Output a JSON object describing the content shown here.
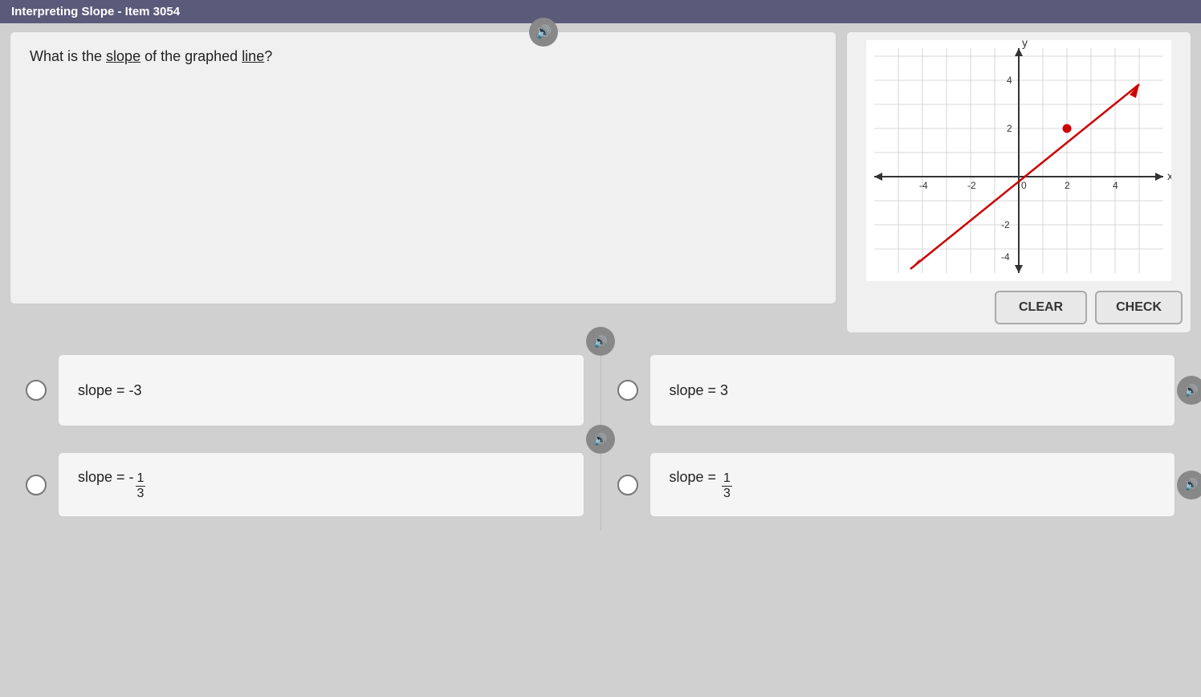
{
  "title": "Interpreting Slope - Item 3054",
  "question": {
    "text_before": "What is the ",
    "slope_word": "slope",
    "text_middle": " of the graphed ",
    "line_word": "line",
    "text_after": "?"
  },
  "buttons": {
    "clear": "CLEAR",
    "check": "CHECK"
  },
  "graph": {
    "x_label": "x",
    "y_label": "y"
  },
  "answers": [
    {
      "id": "a",
      "label": "slope = -3",
      "selected": false
    },
    {
      "id": "b",
      "label": "slope = 3",
      "selected": false
    },
    {
      "id": "c",
      "label": "slope = -1/3",
      "selected": false
    },
    {
      "id": "d",
      "label": "slope = 1/3",
      "selected": false
    }
  ],
  "audio": {
    "icon": "🔊"
  }
}
